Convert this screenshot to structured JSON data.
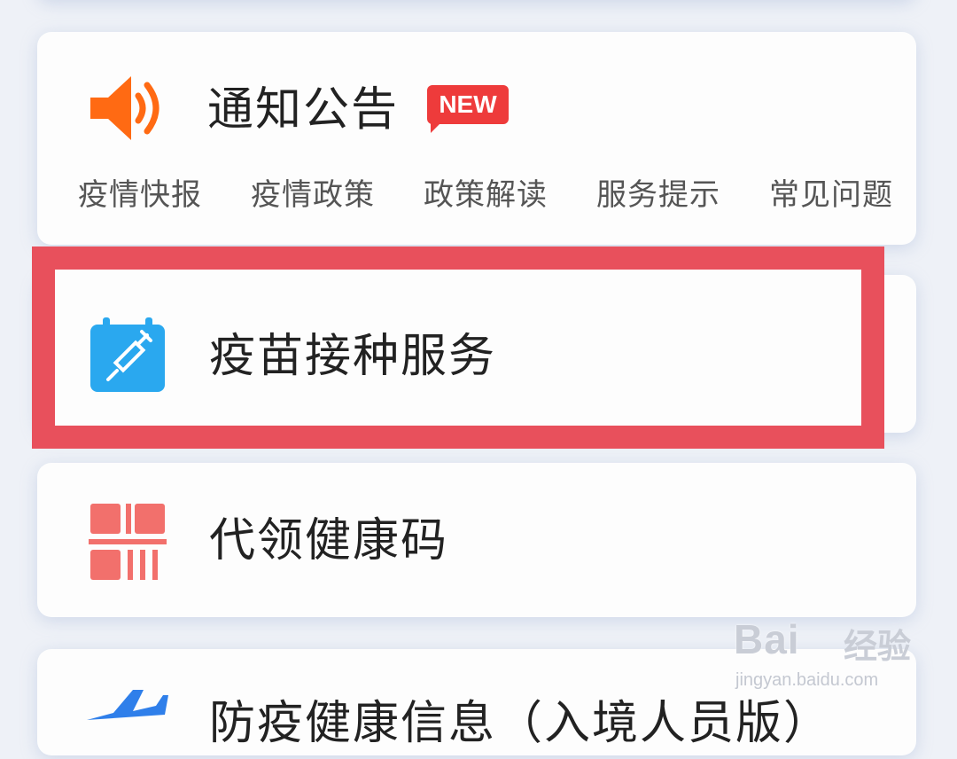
{
  "notice": {
    "title": "通知公告",
    "badge": "NEW",
    "icon": "speaker-icon",
    "links": [
      "疫情快报",
      "疫情政策",
      "政策解读",
      "服务提示",
      "常见问题"
    ]
  },
  "services": [
    {
      "label": "疫苗接种服务",
      "icon": "syringe-calendar-icon",
      "highlighted": true
    },
    {
      "label": "代领健康码",
      "icon": "qr-code-icon"
    },
    {
      "label": "防疫健康信息（入境人员版）",
      "icon": "airplane-icon"
    }
  ],
  "colors": {
    "highlight": "#e8505c",
    "speaker": "#ff6a13",
    "syringe_bg": "#2aa8ef",
    "qr": "#f2706c",
    "airplane": "#2f7fea",
    "badge": "#ee3b3b"
  },
  "watermark": {
    "brand": "Bai",
    "brand_tail": "经验",
    "url": "jingyan.baidu.com"
  }
}
